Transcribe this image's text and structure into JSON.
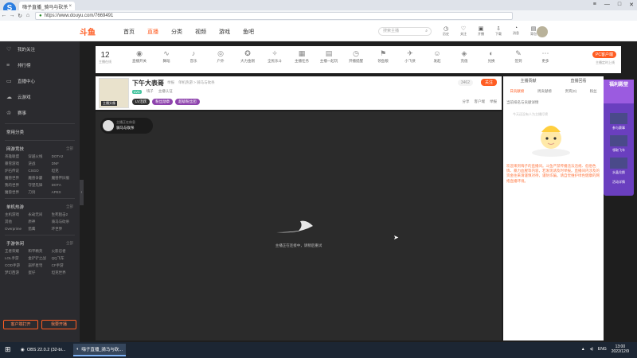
{
  "browser": {
    "tab_title": "嗨子直播_骑马与砍杀",
    "url": "https://www.douyu.com/7669491",
    "colors": {
      "accent": "#ff5d23",
      "app_blue": "#2a7de1"
    }
  },
  "header": {
    "logo_text": "斗鱼",
    "nav": [
      {
        "label": "首页",
        "active": false
      },
      {
        "label": "直播",
        "active": true
      },
      {
        "label": "分类",
        "active": false
      },
      {
        "label": "视频",
        "active": false
      },
      {
        "label": "游戏",
        "active": false
      },
      {
        "label": "鱼吧",
        "active": false
      }
    ],
    "search_placeholder": "搜索主播",
    "icons": [
      {
        "label": "历史",
        "icon": "history-icon"
      },
      {
        "label": "关注",
        "icon": "heart-icon"
      },
      {
        "label": "开播",
        "icon": "camera-icon"
      },
      {
        "label": "下载",
        "icon": "download-icon"
      },
      {
        "label": "消息",
        "icon": "bell-icon"
      },
      {
        "label": "背包",
        "icon": "bag-icon"
      }
    ]
  },
  "sidebar": {
    "main": [
      {
        "label": "我的关注",
        "icon": "heart-icon"
      },
      {
        "label": "排行榜",
        "icon": "rank-icon"
      },
      {
        "label": "直播中心",
        "icon": "tv-icon"
      },
      {
        "label": "云游戏",
        "icon": "cloud-icon"
      },
      {
        "label": "赛事",
        "icon": "trophy-icon"
      }
    ],
    "common": "常用分类",
    "sections": [
      {
        "title": "网游竞技",
        "more": "全部",
        "items": [
          "英雄联盟",
          "穿越火线",
          "DOTA2",
          "暴雪游戏",
          "逆战",
          "DNF",
          "炉石传说",
          "CSGO",
          "坦克",
          "魔兽世界",
          "魔兽争霸",
          "魔兽怀旧服",
          "我的世界",
          "守望先锋",
          "DOTA",
          "魔兽世界",
          "刀剑",
          "APEX"
        ]
      },
      {
        "title": "单机热游",
        "more": "全部",
        "items": [
          "主机游戏",
          "永劫无间",
          "生死狙击2",
          "其他",
          "原神",
          "骑马与砍杀",
          "Overprime",
          "猎鹰",
          "环世界"
        ]
      },
      {
        "title": "手游休闲",
        "more": "全部",
        "items": [
          "王者荣耀",
          "和平精英",
          "火影忍者",
          "LOL手游",
          "金铲铲之战",
          "QQ飞车",
          "COD手游",
          "崩坏星穹",
          "CF手游",
          "梦幻西游",
          "蛋仔",
          "坦克世界"
        ]
      }
    ],
    "buttons": [
      "客户端打开",
      "我要开播"
    ]
  },
  "categories": {
    "online_count": "12",
    "online_label": "主播在线",
    "items": [
      "直播开关",
      "舞蹈",
      "音乐",
      "户外",
      "大力金刚",
      "全民乐斗",
      "主播任务",
      "主播一起玩",
      "开播提醒",
      "领鱼粮",
      "小飞侠",
      "发起",
      "充值",
      "兑换",
      "签到",
      "更多"
    ],
    "pc_client": "PC客户端",
    "pc_sub": "主播定时上线"
  },
  "room": {
    "title": "下午大表哥",
    "report": "举报",
    "category": "单机热游 > 骑马与砍杀",
    "level": "LV1",
    "anchor": "嗨子",
    "tag": "主播认证",
    "badges": [
      "LV活跃",
      "粉丝勋章",
      "超级粉丝团"
    ],
    "thumb_tag": "主播头像",
    "fans": "3462",
    "follow": "关注",
    "tools": [
      "分享",
      "客户端",
      "举报"
    ]
  },
  "player": {
    "anchor_status": "主播正在休息",
    "anchor_name": "骑马与砍杀",
    "message": "主播正在连接中，请稍后重试"
  },
  "right_panel": {
    "tabs": [
      "主播贡献",
      "直播回看"
    ],
    "sub_tabs": [
      "日贡献榜",
      "周贡献榜",
      "贵宾(0)",
      "粉丝"
    ],
    "rank_note": "当前排名与贡献详情",
    "tip": "今天还没有人为主播打榜",
    "notice": "欢迎来到嗨子的直播间。斗鱼严禁传播违法违规、低俗色情、暴力血腥等内容，若发现请及时举报。直播间内涉及的资金往来请谨慎对待，谨防诈骗。请自觉维护绿色健康的网络直播环境。"
  },
  "promo": {
    "top": "福利殿堂",
    "items": [
      "参与赛事",
      "领取飞车",
      "水晶兑换",
      "活动详情"
    ]
  },
  "taskbar": {
    "apps": [
      {
        "label": "OBS 22.0.2 (32-bi...",
        "active": false
      },
      {
        "label": "嗨子直播_骑马与砍...",
        "active": true
      }
    ],
    "lang": "ENG",
    "time": "13:00",
    "date": "2022/12/9"
  }
}
